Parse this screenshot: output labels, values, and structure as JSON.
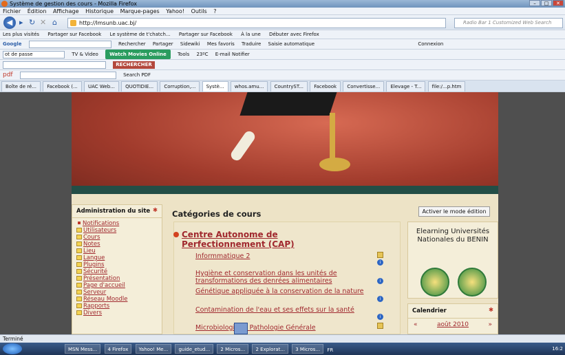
{
  "window": {
    "title": "Système de gestion des cours - Mozilla Firefox"
  },
  "menu": [
    "Fichier",
    "Édition",
    "Affichage",
    "Historique",
    "Marque-pages",
    "Yahoo!",
    "Outils",
    "?"
  ],
  "nav": {
    "url": "http://lmsunb.uac.bj/",
    "search_placeholder": "Radio Bar 1 Customized Web Search"
  },
  "bookmarks": [
    "Les plus visités",
    "Partager sur Facebook",
    "Le système de t'chatch...",
    "Partager sur Facebook",
    "À la une",
    "Débuter avec Firefox"
  ],
  "toolbar1": [
    "Google",
    "Rechercher",
    "Partager",
    "Sidewiki",
    "Mes favoris",
    "Traduire",
    "Saisie automatique",
    "Connexion"
  ],
  "toolbar2": {
    "field": "ot de passe",
    "tv": "TV & Video",
    "watch": "Watch Movies Online",
    "tools": "Tools",
    "weather": "23ºC",
    "email": "E-mail Notifier"
  },
  "toolbar3": {
    "search_button": "RECHERCHER"
  },
  "toolbar4": {
    "label": "pdf",
    "search_pdf": "Search PDF"
  },
  "tabs": [
    {
      "label": "Boîte de ré...",
      "active": false
    },
    {
      "label": "Facebook (...",
      "active": false
    },
    {
      "label": "UAC Web...",
      "active": false
    },
    {
      "label": "QUOTIDIE...",
      "active": false
    },
    {
      "label": "Corruption,...",
      "active": false
    },
    {
      "label": "Systè...",
      "active": true
    },
    {
      "label": "whos.amu...",
      "active": false
    },
    {
      "label": "CountryST...",
      "active": false
    },
    {
      "label": "Facebook",
      "active": false
    },
    {
      "label": "Convertisse...",
      "active": false
    },
    {
      "label": "Elevage - T...",
      "active": false
    },
    {
      "label": "file:/...p.htm",
      "active": false
    }
  ],
  "sidebar": {
    "title": "Administration du site",
    "items": [
      "Notifications",
      "Utilisateurs",
      "Cours",
      "Notes",
      "Lieu",
      "Langue",
      "Plugins",
      "Sécurité",
      "Présentation",
      "Page d'accueil",
      "Serveur",
      "Réseau Moodle",
      "Rapports",
      "Divers"
    ]
  },
  "main": {
    "title": "Catégories de cours",
    "edit_button": "Activer le mode édition",
    "category": "Centre Autonome de Perfectionnement (CAP)",
    "courses": [
      "Informmatique 2",
      "Hygiène et conservation dans les unités de transformations des denrées alimentaires",
      "Génétique appliquée à la conservation de la nature",
      "Contamination de l'eau et ses effets sur la santé",
      "Microbiologie et Pathologie Générale"
    ]
  },
  "right": {
    "title": "Elearning Universités Nationales du BENIN",
    "calendar_title": "Calendrier",
    "month": "août 2010",
    "prev": "«",
    "next": "»"
  },
  "status": "Terminé",
  "taskbar": {
    "tasks": [
      "MSN Mess...",
      "4 Firefox",
      "Yahoo! Me...",
      "guide_etud...",
      "2 Micros...",
      "2 Explorat...",
      "3 Micros..."
    ],
    "lang": "FR",
    "clock": "16:2"
  }
}
